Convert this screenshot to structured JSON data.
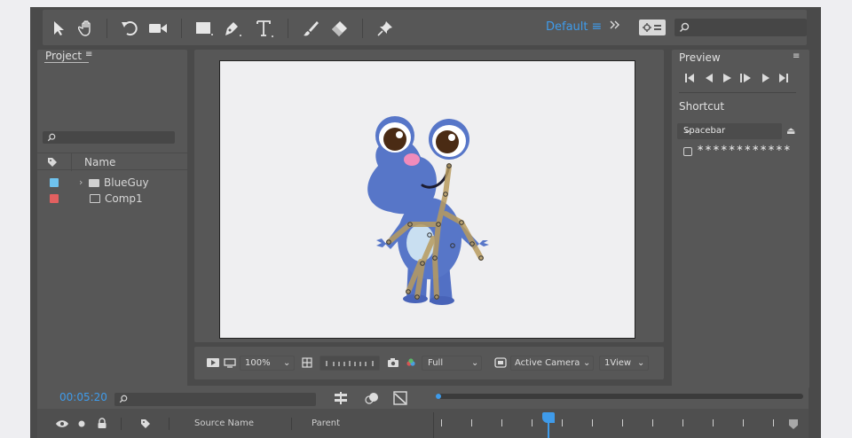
{
  "toolbar": {
    "tools": [
      "selection-tool",
      "hand-tool",
      "rotation-tool",
      "camera-tool",
      "rectangle-tool",
      "pen-tool",
      "type-tool",
      "brush-tool",
      "eraser-tool",
      "puppet-pin-tool"
    ],
    "workspace_label": "Default",
    "workspace_menu_icon": "≡",
    "overflow_icon": "»",
    "search_icon": "search-icon"
  },
  "project": {
    "tab_label": "Project",
    "tab_menu_icon": "≡",
    "column_name": "Name",
    "items": [
      {
        "label": "BlueGuy",
        "kind": "folder",
        "color": "#6fc3ef"
      },
      {
        "label": "Comp1",
        "kind": "composition",
        "color": "#e26060"
      }
    ]
  },
  "viewer_bar": {
    "zoom": "100%",
    "resolution": "Full",
    "camera": "Active Camera",
    "views": "1View"
  },
  "preview": {
    "title": "Preview",
    "menu_icon": "≡",
    "shortcut_title": "Shortcut",
    "shortcut_value": "Spacebar",
    "shortcut_mask": "∗∗∗∗∗∗∗∗∗∗∗∗"
  },
  "timeline": {
    "timecode": "00:05:20",
    "col_source": "Source Name",
    "col_parent": "Parent",
    "playhead_position": 0.3
  },
  "colors": {
    "accent": "#3f9bea",
    "panel": "#575757",
    "frame": "#4a4a4a",
    "character": "#5776c8",
    "bones": "#b89b5e"
  }
}
